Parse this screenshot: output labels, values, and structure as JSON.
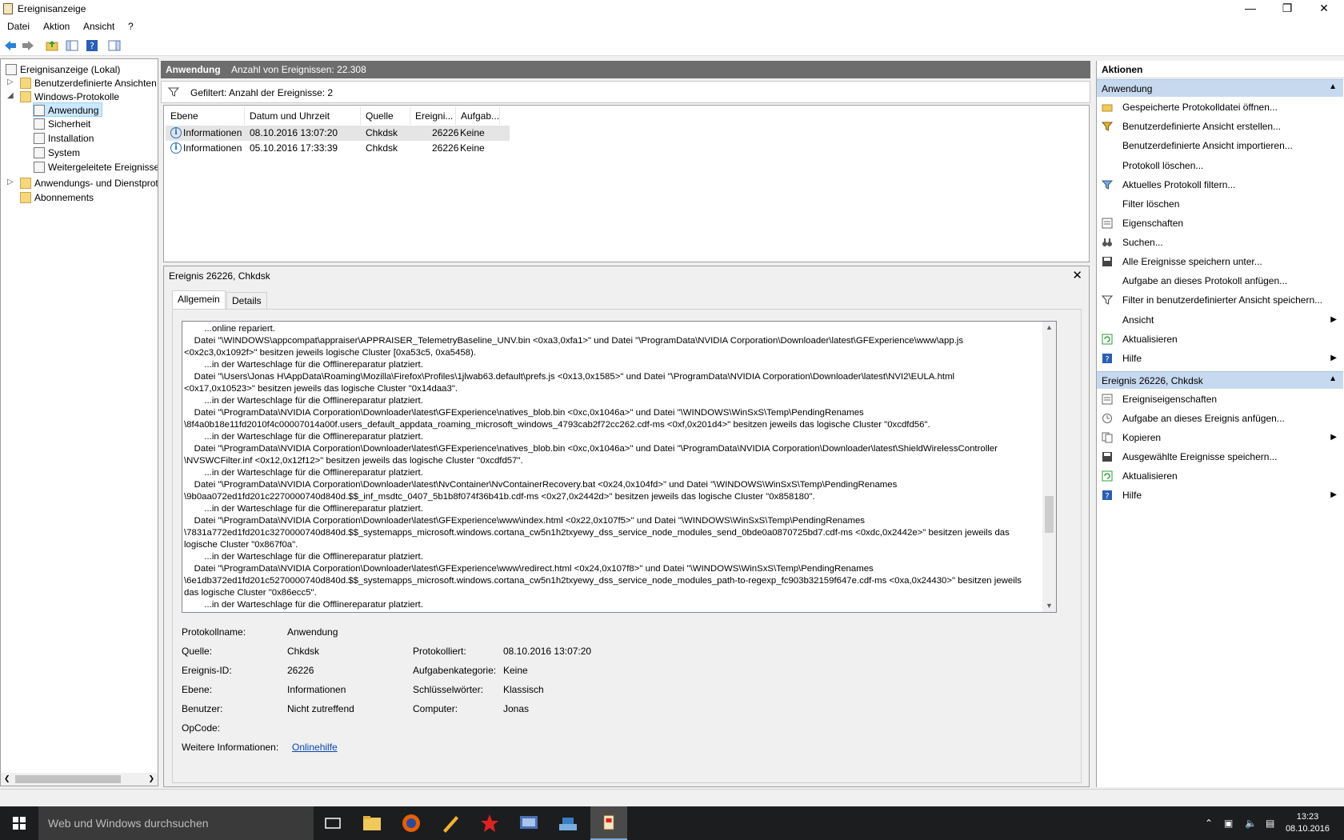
{
  "window": {
    "title": "Ereignisanzeige"
  },
  "menu": [
    "Datei",
    "Aktion",
    "Ansicht",
    "?"
  ],
  "tree": {
    "root": "Ereignisanzeige (Lokal)",
    "items": [
      "Benutzerdefinierte Ansichten",
      "Windows-Protokolle",
      "Anwendung",
      "Sicherheit",
      "Installation",
      "System",
      "Weitergeleitete Ereignisse",
      "Anwendungs- und Dienstprotokolle",
      "Abonnements"
    ]
  },
  "header": {
    "log": "Anwendung",
    "count": "Anzahl von Ereignissen: 22.308"
  },
  "filter": {
    "text": "Gefiltert: Anzahl der Ereignisse: 2"
  },
  "events": {
    "columns": [
      "Ebene",
      "Datum und Uhrzeit",
      "Quelle",
      "Ereigni...",
      "Aufgab..."
    ],
    "rows": [
      [
        "Informationen",
        "08.10.2016 13:07:20",
        "Chkdsk",
        "26226",
        "Keine"
      ],
      [
        "Informationen",
        "05.10.2016 17:33:39",
        "Chkdsk",
        "26226",
        "Keine"
      ]
    ]
  },
  "detail": {
    "title": "Ereignis 26226, Chkdsk",
    "tabs": [
      "Allgemein",
      "Details"
    ],
    "description": "        ...online repariert.\n    Datei \"\\WINDOWS\\appcompat\\appraiser\\APPRAISER_TelemetryBaseline_UNV.bin <0xa3,0xfa1>\" und Datei \"\\ProgramData\\NVIDIA Corporation\\Downloader\\latest\\GFExperience\\www\\app.js\n<0x2c3,0x1092f>\" besitzen jeweils logische Cluster [0xa53c5, 0xa5458).\n        ...in der Warteschlage für die Offlinereparatur platziert.\n    Datei \"\\Users\\Jonas H\\AppData\\Roaming\\Mozilla\\Firefox\\Profiles\\1jlwab63.default\\prefs.js <0x13,0x1585>\" und Datei \"\\ProgramData\\NVIDIA Corporation\\Downloader\\latest\\NVI2\\EULA.html\n<0x17,0x10523>\" besitzen jeweils das logische Cluster \"0x14daa3\".\n        ...in der Warteschlage für die Offlinereparatur platziert.\n    Datei \"\\ProgramData\\NVIDIA Corporation\\Downloader\\latest\\GFExperience\\natives_blob.bin <0xc,0x1046a>\" und Datei \"\\WINDOWS\\WinSxS\\Temp\\PendingRenames\n\\8f4a0b18e11fd2010f4c00007014a00f.users_default_appdata_roaming_microsoft_windows_4793cab2f72cc262.cdf-ms <0xf,0x201d4>\" besitzen jeweils das logische Cluster \"0xcdfd56\".\n        ...in der Warteschlage für die Offlinereparatur platziert.\n    Datei \"\\ProgramData\\NVIDIA Corporation\\Downloader\\latest\\GFExperience\\natives_blob.bin <0xc,0x1046a>\" und Datei \"\\ProgramData\\NVIDIA Corporation\\Downloader\\latest\\ShieldWirelessController\n\\NVSWCFilter.inf <0x12,0x12f12>\" besitzen jeweils das logische Cluster \"0xcdfd57\".\n        ...in der Warteschlage für die Offlinereparatur platziert.\n    Datei \"\\ProgramData\\NVIDIA Corporation\\Downloader\\latest\\NvContainer\\NvContainerRecovery.bat <0x24,0x104fd>\" und Datei \"\\WINDOWS\\WinSxS\\Temp\\PendingRenames\n\\9b0aa072ed1fd201c2270000740d840d.$$_inf_msdtc_0407_5b1b8f074f36b41b.cdf-ms <0x27,0x2442d>\" besitzen jeweils das logische Cluster \"0x858180\".\n        ...in der Warteschlage für die Offlinereparatur platziert.\n    Datei \"\\ProgramData\\NVIDIA Corporation\\Downloader\\latest\\GFExperience\\www\\index.html <0x22,0x107f5>\" und Datei \"\\WINDOWS\\WinSxS\\Temp\\PendingRenames\n\\7831a772ed1fd201c3270000740d840d.$$_systemapps_microsoft.windows.cortana_cw5n1h2txyewy_dss_service_node_modules_send_0bde0a0870725bd7.cdf-ms <0xdc,0x2442e>\" besitzen jeweils das\nlogische Cluster \"0x867f0a\".\n        ...in der Warteschlage für die Offlinereparatur platziert.\n    Datei \"\\ProgramData\\NVIDIA Corporation\\Downloader\\latest\\GFExperience\\www\\redirect.html <0x24,0x107f8>\" und Datei \"\\WINDOWS\\WinSxS\\Temp\\PendingRenames\n\\6e1db372ed1fd201c5270000740d840d.$$_systemapps_microsoft.windows.cortana_cw5n1h2txyewy_dss_service_node_modules_path-to-regexp_fc903b32159f647e.cdf-ms <0xa,0x24430>\" besitzen jeweils\ndas logische Cluster \"0x86ecc5\".\n        ...in der Warteschlage für die Offlinereparatur platziert.",
    "props": {
      "protokollname_label": "Protokollname:",
      "protokollname": "Anwendung",
      "quelle_label": "Quelle:",
      "quelle": "Chkdsk",
      "protokolliert_label": "Protokolliert:",
      "protokolliert": "08.10.2016 13:07:20",
      "id_label": "Ereignis-ID:",
      "id": "26226",
      "aufgabe_label": "Aufgabenkategorie:",
      "aufgabe": "Keine",
      "ebene_label": "Ebene:",
      "ebene": "Informationen",
      "schluessel_label": "Schlüsselwörter:",
      "schluessel": "Klassisch",
      "benutzer_label": "Benutzer:",
      "benutzer": "Nicht zutreffend",
      "computer_label": "Computer:",
      "computer": "Jonas",
      "opcode_label": "OpCode:",
      "info_label": "Weitere Informationen:",
      "info_link": "Onlinehilfe"
    }
  },
  "actions": {
    "header": "Aktionen",
    "section1": "Anwendung",
    "items1": [
      "Gespeicherte Protokolldatei öffnen...",
      "Benutzerdefinierte Ansicht erstellen...",
      "Benutzerdefinierte Ansicht importieren...",
      "Protokoll löschen...",
      "Aktuelles Protokoll filtern...",
      "Filter löschen",
      "Eigenschaften",
      "Suchen...",
      "Alle Ereignisse speichern unter...",
      "Aufgabe an dieses Protokoll anfügen...",
      "Filter in benutzerdefinierter Ansicht speichern...",
      "Ansicht",
      "Aktualisieren",
      "Hilfe"
    ],
    "section2": "Ereignis 26226, Chkdsk",
    "items2": [
      "Ereigniseigenschaften",
      "Aufgabe an dieses Ereignis anfügen...",
      "Kopieren",
      "Ausgewählte Ereignisse speichern...",
      "Aktualisieren",
      "Hilfe"
    ]
  },
  "taskbar": {
    "search_placeholder": "Web und Windows durchsuchen",
    "time": "13:23",
    "date": "08.10.2016"
  }
}
